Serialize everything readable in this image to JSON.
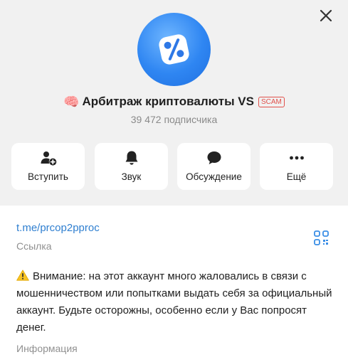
{
  "channel": {
    "emoji": "🧠",
    "title": "Арбитраж криптовалюты VS",
    "badge": "SCAM",
    "subscribers": "39 472 подписчика"
  },
  "actions": [
    {
      "label": "Вступить",
      "icon": "add-user-icon"
    },
    {
      "label": "Звук",
      "icon": "bell-icon"
    },
    {
      "label": "Обсуждение",
      "icon": "chat-bubble-icon"
    },
    {
      "label": "Ещё",
      "icon": "more-dots-icon"
    }
  ],
  "link": {
    "url": "t.me/prcop2pproc",
    "caption": "Ссылка"
  },
  "info": {
    "text": "Внимание: на этот аккаунт много жаловались в связи с мошенничеством или попытками выдать себя за официальный аккаунт. Будьте осторожны, особенно если у Вас попросят денег.",
    "caption": "Информация"
  },
  "colors": {
    "accent": "#2f7fd0",
    "scam": "#e0514b",
    "avatar": "#2f86f2"
  }
}
